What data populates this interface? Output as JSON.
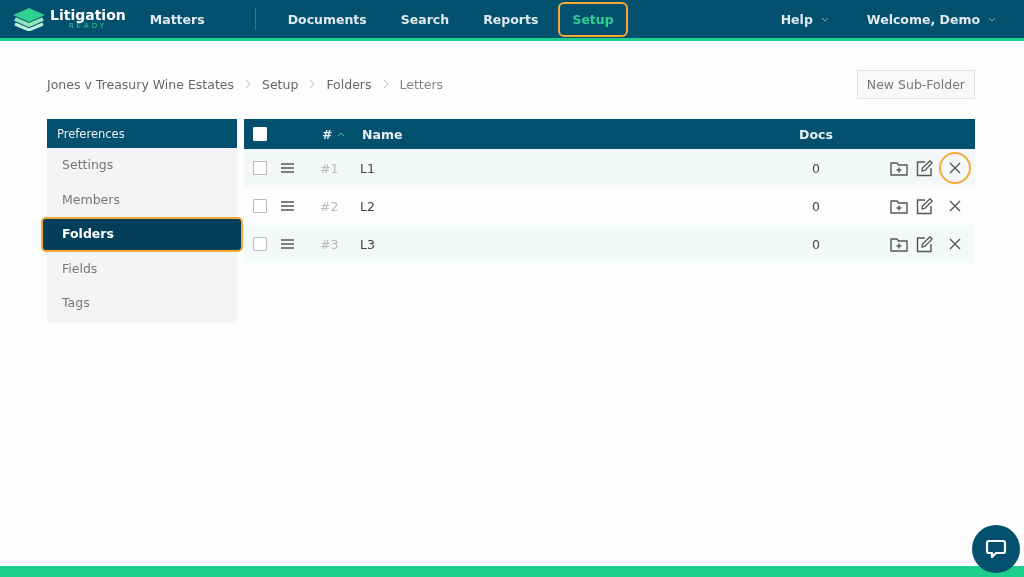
{
  "brand": {
    "name": "Litigation",
    "tagline": "READY"
  },
  "nav": [
    {
      "label": "Matters",
      "selected": false,
      "highlighted": false
    },
    {
      "label": "Documents",
      "selected": false,
      "highlighted": false
    },
    {
      "label": "Search",
      "selected": false,
      "highlighted": false
    },
    {
      "label": "Reports",
      "selected": false,
      "highlighted": false
    },
    {
      "label": "Setup",
      "selected": true,
      "highlighted": true
    }
  ],
  "nav_right": [
    {
      "label": "Help"
    },
    {
      "label": "Welcome, Demo"
    }
  ],
  "breadcrumb": [
    "Jones v Treasury Wine Estates",
    "Setup",
    "Folders",
    "Letters"
  ],
  "new_button": "New Sub-Folder",
  "sidebar": {
    "header": "Preferences",
    "items": [
      {
        "label": "Settings",
        "selected": false,
        "highlighted": false
      },
      {
        "label": "Members",
        "selected": false,
        "highlighted": false
      },
      {
        "label": "Folders",
        "selected": true,
        "highlighted": true
      },
      {
        "label": "Fields",
        "selected": false,
        "highlighted": false
      },
      {
        "label": "Tags",
        "selected": false,
        "highlighted": false
      }
    ]
  },
  "table": {
    "columns": [
      "#",
      "Name",
      "Docs"
    ],
    "select_all_checked": false,
    "rows": [
      {
        "number": "#1",
        "name": "L1",
        "docs": "0",
        "checked": false,
        "delete_highlighted": true
      },
      {
        "number": "#2",
        "name": "L2",
        "docs": "0",
        "checked": false,
        "delete_highlighted": false
      },
      {
        "number": "#3",
        "name": "L3",
        "docs": "0",
        "checked": false,
        "delete_highlighted": false
      }
    ]
  }
}
